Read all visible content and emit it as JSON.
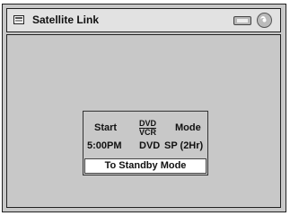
{
  "window": {
    "title": "Satellite Link",
    "icons": [
      "menu-icon",
      "tape-icon",
      "disc-icon"
    ]
  },
  "timer": {
    "headers": {
      "start": "Start",
      "media_top": "DVD",
      "media_bottom": "VCR",
      "mode": "Mode"
    },
    "values": {
      "start": "5:00PM",
      "media": "DVD",
      "mode": "SP (2Hr)"
    }
  },
  "action": {
    "standby_label": "To Standby Mode"
  }
}
